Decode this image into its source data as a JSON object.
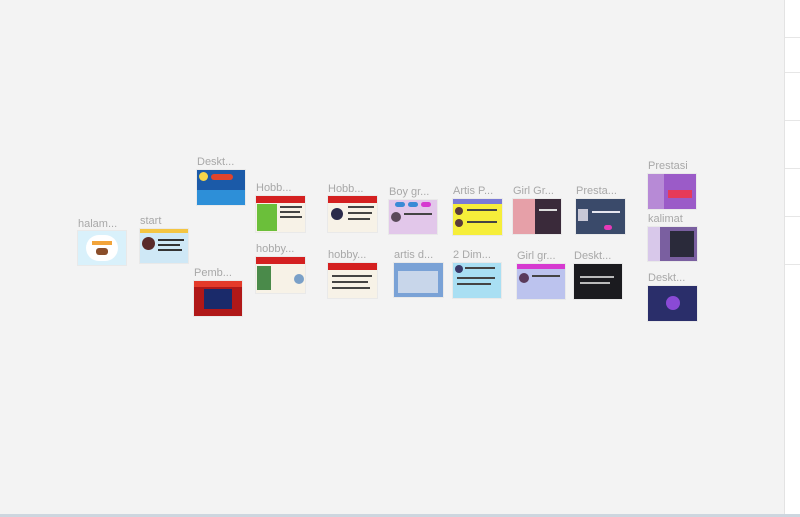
{
  "frames": [
    {
      "label": "halam...",
      "bg": "#d9f1fb"
    },
    {
      "label": "start",
      "bg": "#cfe8f6"
    },
    {
      "label": "Deskt...",
      "bg": "#1b5aa8"
    },
    {
      "label": "Pemb...",
      "bg": "#b01818"
    },
    {
      "label": "Hobb...",
      "bg": "#f7f2e7"
    },
    {
      "label": "hobby...",
      "bg": "#f7f2e7"
    },
    {
      "label": "Hobb...",
      "bg": "#f7f2e7"
    },
    {
      "label": "hobby...",
      "bg": "#f7f2e7"
    },
    {
      "label": "Boy gr...",
      "bg": "#e2c7ea"
    },
    {
      "label": "artis d...",
      "bg": "#7aa2d6"
    },
    {
      "label": "Artis P...",
      "bg": "#f6ee3a"
    },
    {
      "label": "2 Dim...",
      "bg": "#a9dff3"
    },
    {
      "label": "Girl Gr...",
      "bg": "#3a2a3a"
    },
    {
      "label": "Girl gr...",
      "bg": "#bcc3ee"
    },
    {
      "label": "Presta...",
      "bg": "#3a4a6a"
    },
    {
      "label": "Deskt...",
      "bg": "#1b1b1f"
    },
    {
      "label": "Prestasi",
      "bg": "#9b5bc8"
    },
    {
      "label": "kalimat",
      "bg": "#7a5fa0"
    },
    {
      "label": "Deskt...",
      "bg": "#2a2e6a"
    }
  ]
}
